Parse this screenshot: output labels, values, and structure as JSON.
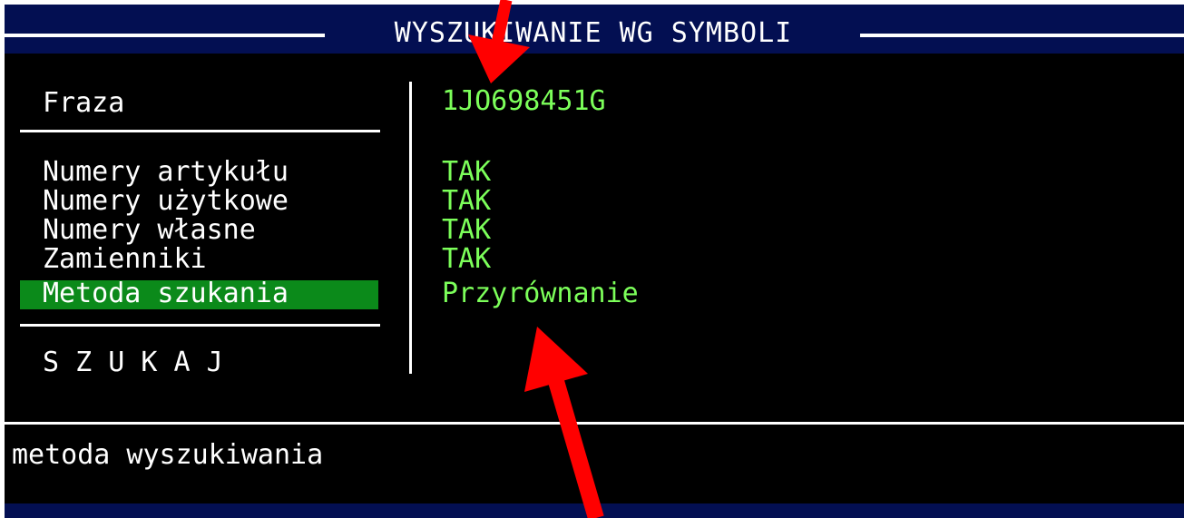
{
  "window": {
    "title": "WYSZUKIWANIE WG SYMBOLI"
  },
  "form": {
    "phrase_label": "Fraza",
    "phrase_value": "1JO698451G",
    "options": [
      {
        "label": "Numery artykułu",
        "value": "TAK"
      },
      {
        "label": "Numery użytkowe",
        "value": "TAK"
      },
      {
        "label": "Numery własne",
        "value": "TAK"
      },
      {
        "label": "Zamienniki",
        "value": "TAK"
      },
      {
        "label": "Metoda szukania",
        "value": "Przyrównanie"
      }
    ],
    "search_label": "S Z U K A J"
  },
  "status": {
    "hint": "metoda wyszukiwania"
  },
  "colors": {
    "background": "#000000",
    "title_bar": "#030f52",
    "text": "#ffffff",
    "value_text": "#7cff5a",
    "highlight": "#0b8a1a",
    "arrow": "#ff0000"
  }
}
